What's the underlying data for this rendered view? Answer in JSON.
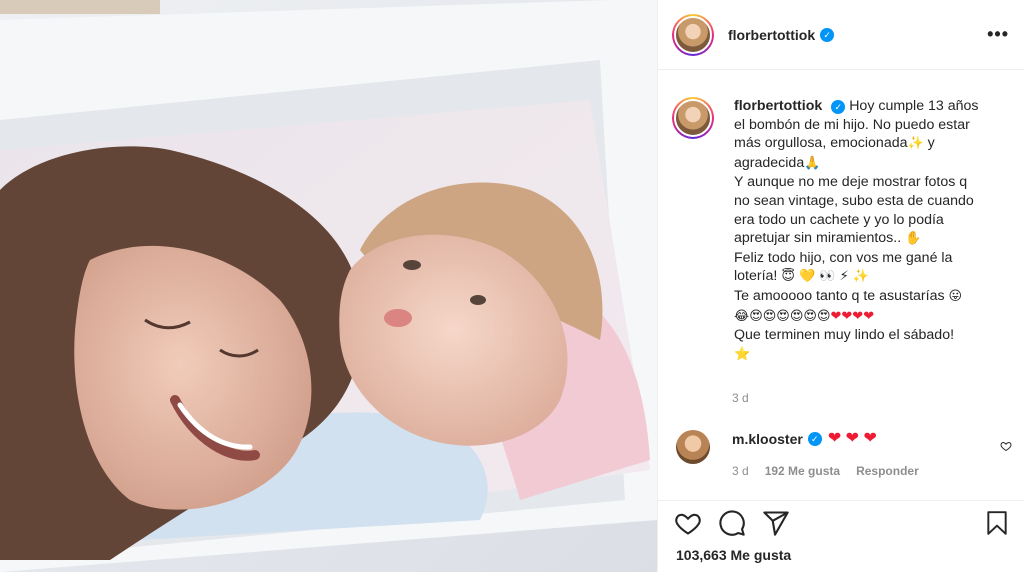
{
  "post": {
    "username": "florbertottiok",
    "more_label": "•••"
  },
  "caption": {
    "username": "florbertottiok",
    "line1": "Hoy cumple 13 años",
    "line2": "el bombón de mi hijo. No puedo estar",
    "line3": "más orgullosa, emocionada",
    "line3b": " y",
    "line4": "agradecida",
    "line5": "Y aunque no me deje mostrar fotos q",
    "line6": "no sean vintage, subo esta de cuando",
    "line7": "era todo un cachete y yo lo podía",
    "line8": "apretujar sin miramientos..",
    "line9": "Feliz todo hijo, con vos me gané la",
    "line10": "lotería!",
    "line11": "Te amooooo tanto q te asustarías",
    "line13": "Que terminen muy lindo el sábado!",
    "time": "3 d"
  },
  "comment": {
    "username": "m.klooster",
    "time": "3 d",
    "likes": "192 Me gusta",
    "reply_label": "Responder"
  },
  "post_likes": "103,663 Me gusta",
  "icons": {
    "verified": "verified-badge-icon",
    "more": "more-options-icon",
    "like": "heart-icon",
    "comment": "comment-icon",
    "share": "share-icon",
    "save": "bookmark-icon"
  },
  "colors": {
    "verified_blue": "#0095f6",
    "text": "#262626",
    "meta_gray": "#8e8e8e",
    "heart_red": "#ed1c33"
  }
}
